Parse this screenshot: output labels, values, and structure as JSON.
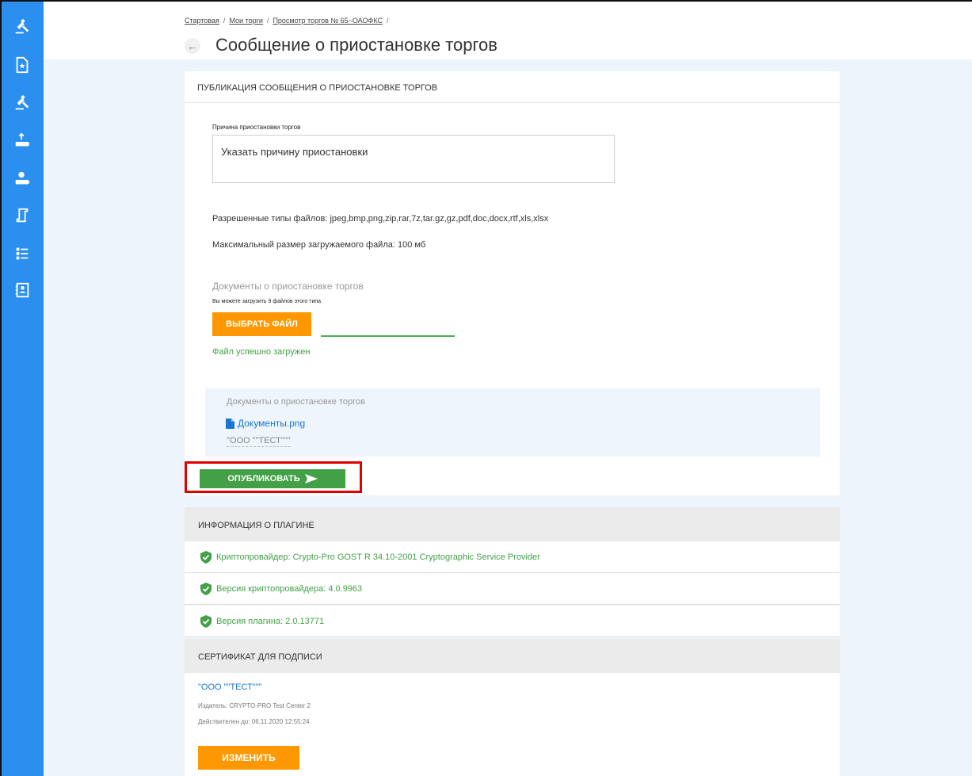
{
  "breadcrumb": {
    "items": [
      "Стартовая",
      "Мои торги",
      "Просмотр торгов № 65~ОАОФКС"
    ],
    "separator": "/"
  },
  "page": {
    "title": "Сообщение о приостановке торгов"
  },
  "sidebar": {
    "icons": [
      "gavel-icon",
      "document-icon",
      "gavel-icon",
      "lot-upload-icon",
      "lot-download-icon",
      "scroll-icon",
      "list-icon",
      "contacts-icon"
    ]
  },
  "publication": {
    "header": "ПУБЛИКАЦИЯ СООБЩЕНИЯ О ПРИОСТАНОВКЕ ТОРГОВ",
    "reason_label": "Причина приостановки торгов",
    "reason_placeholder": "Указать причину приостановки",
    "allowed_types": "Разрешенные типы файлов: jpeg,bmp,png,zip,rar,7z,tar.gz,gz,pdf,doc,docx,rtf,xls,xlsx",
    "max_size": "Максимальный размер загружаемого файла: 100 мб",
    "docs_label": "Документы о приостановке торгов",
    "docs_hint": "Вы можете загрузить 9 файлов этого типа",
    "choose_file_label": "ВЫБРАТЬ ФАЙЛ",
    "upload_success": "Файл успешно загружен",
    "uploaded": {
      "title": "Документы о приостановке торгов",
      "file_name": "Документы.png",
      "owner": "\"ООО \"\"ТЕСТ\"\"\""
    },
    "publish_label": "ОПУБЛИКОВАТЬ"
  },
  "plugin": {
    "header": "ИНФОРМАЦИЯ О ПЛАГИНЕ",
    "rows": [
      "Криптопровайдер: Crypto-Pro GOST R 34.10-2001 Cryptographic Service Provider",
      "Версия криптопровайдера: 4.0.9963",
      "Версия плагина: 2.0.13771"
    ]
  },
  "certificate": {
    "header": "СЕРТИФИКАТ ДЛЯ ПОДПИСИ",
    "name": "\"ООО \"\"ТЕСТ\"\"\"",
    "issuer": "Издатель: CRYPTO-PRO Test Center 2",
    "valid_until": "Действителен до: 06.11.2020 12:55:24",
    "change_label": "ИЗМЕНИТЬ"
  },
  "colors": {
    "sidebar": "#2b8ff0",
    "accent_orange": "#ff9800",
    "accent_green": "#43a047",
    "highlight_red": "#e00000",
    "link_blue": "#1976d2"
  }
}
